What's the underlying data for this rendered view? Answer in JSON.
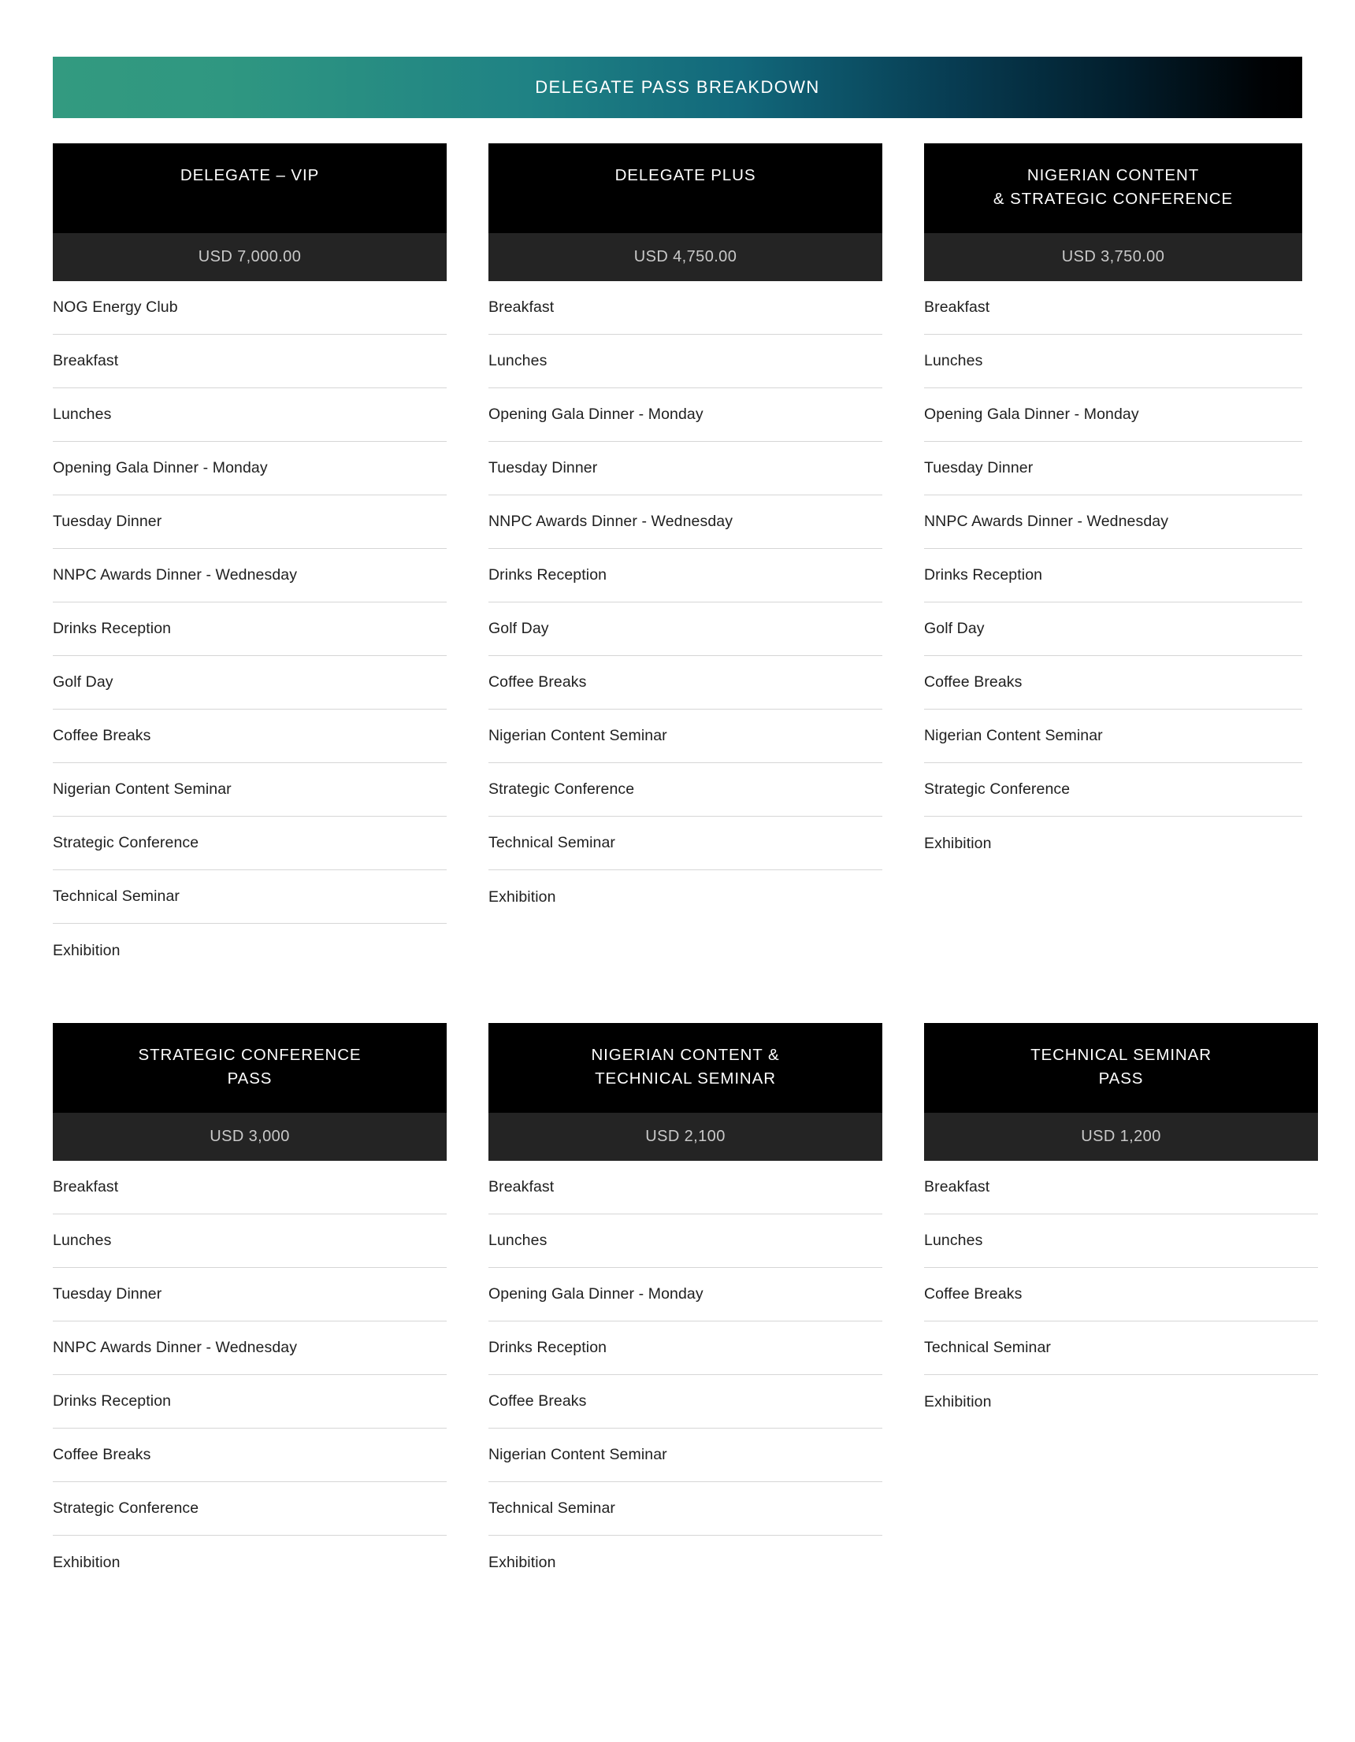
{
  "banner": {
    "title": "DELEGATE PASS BREAKDOWN",
    "gradient_from": "#339a80",
    "gradient_mid": "#12687b",
    "gradient_to": "#000000"
  },
  "theme": {
    "header_bg": "#000000",
    "price_bg": "#242424",
    "price_text": "#c9c9c9",
    "item_text": "#202020",
    "divider": "#d6d6d6",
    "page_bg": "#ffffff"
  },
  "cards": [
    {
      "title": "DELEGATE – VIP",
      "price": "USD 7,000.00",
      "items": [
        "NOG Energy Club",
        "Breakfast",
        "Lunches",
        "Opening Gala Dinner - Monday",
        "Tuesday Dinner",
        "NNPC Awards Dinner - Wednesday",
        "Drinks Reception",
        "Golf Day",
        "Coffee Breaks",
        "Nigerian Content Seminar",
        "Strategic Conference",
        "Technical Seminar",
        "Exhibition"
      ]
    },
    {
      "title": "DELEGATE PLUS",
      "price": "USD 4,750.00",
      "items": [
        "Breakfast",
        "Lunches",
        "Opening Gala Dinner - Monday",
        "Tuesday Dinner",
        "NNPC Awards Dinner - Wednesday",
        "Drinks Reception",
        "Golf Day",
        "Coffee Breaks",
        "Nigerian Content Seminar",
        "Strategic Conference",
        "Technical Seminar",
        "Exhibition"
      ]
    },
    {
      "title": "NIGERIAN CONTENT\n& STRATEGIC CONFERENCE",
      "price": "USD 3,750.00",
      "items": [
        "Breakfast",
        "Lunches",
        "Opening Gala Dinner - Monday",
        "Tuesday Dinner",
        "NNPC Awards Dinner - Wednesday",
        "Drinks Reception",
        "Golf Day",
        "Coffee Breaks",
        "Nigerian Content Seminar",
        "Strategic Conference",
        "Exhibition"
      ]
    },
    {
      "title": "STRATEGIC CONFERENCE\nPASS",
      "price": "USD 3,000",
      "items": [
        "Breakfast",
        "Lunches",
        "Tuesday Dinner",
        "NNPC Awards Dinner - Wednesday",
        "Drinks Reception",
        "Coffee Breaks",
        "Strategic Conference",
        "Exhibition"
      ]
    },
    {
      "title": "NIGERIAN CONTENT &\nTECHNICAL SEMINAR",
      "price": "USD 2,100",
      "items": [
        "Breakfast",
        "Lunches",
        "Opening Gala Dinner - Monday",
        "Drinks Reception",
        "Coffee Breaks",
        "Nigerian Content Seminar",
        "Technical Seminar",
        "Exhibition"
      ]
    },
    {
      "title": "TECHNICAL SEMINAR\nPASS",
      "price": "USD 1,200",
      "items": [
        "Breakfast",
        "Lunches",
        "Coffee Breaks",
        "Technical Seminar",
        "Exhibition"
      ]
    }
  ]
}
